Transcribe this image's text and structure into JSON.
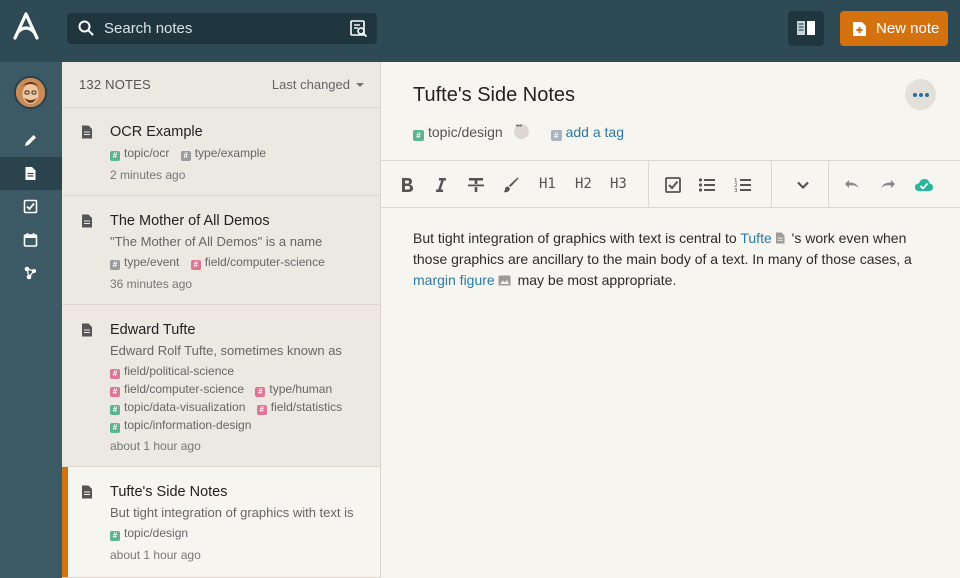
{
  "header": {
    "search_placeholder": "Search notes",
    "new_note_label": "New note"
  },
  "list": {
    "count": "132 NOTES",
    "sort_label": "Last changed",
    "notes": [
      {
        "title": "OCR Example",
        "preview": "",
        "tags": [
          {
            "name": "topic/ocr",
            "color": "#5bb58e"
          },
          {
            "name": "type/example",
            "color": "#9b9b9b"
          }
        ],
        "time": "2 minutes ago"
      },
      {
        "title": "The Mother of All Demos",
        "preview": "\"The Mother of All Demos\" is a name",
        "tags": [
          {
            "name": "type/event",
            "color": "#9b9b9b"
          },
          {
            "name": "field/computer-science",
            "color": "#e17595"
          }
        ],
        "time": "36 minutes ago"
      },
      {
        "title": "Edward Tufte",
        "preview": "Edward Rolf Tufte, sometimes known as",
        "tags": [
          {
            "name": "field/political-science",
            "color": "#e17595"
          },
          {
            "name": "field/computer-science",
            "color": "#e17595"
          },
          {
            "name": "type/human",
            "color": "#e17595"
          },
          {
            "name": "topic/data-visualization",
            "color": "#5bb58e"
          },
          {
            "name": "field/statistics",
            "color": "#e17595"
          },
          {
            "name": "topic/information-design",
            "color": "#5bb58e"
          }
        ],
        "time": "about 1 hour ago"
      },
      {
        "title": "Tufte's Side Notes",
        "preview": "But tight integration of graphics with text is",
        "tags": [
          {
            "name": "topic/design",
            "color": "#5bb58e"
          }
        ],
        "time": "about 1 hour ago"
      }
    ]
  },
  "editor": {
    "title": "Tufte's Side Notes",
    "tag": "topic/design",
    "add_tag": "add a tag",
    "toolbar": {
      "h1": "H1",
      "h2": "H2",
      "h3": "H3"
    },
    "body": {
      "part1": "But tight integration of graphics with text is central to ",
      "link1": "Tufte",
      "part2": " 's work even when those graphics are ancillary to the main body of a text. In many of those cases, a ",
      "link2": "margin figure",
      "part3": " may be most appropriate."
    }
  },
  "colors": {
    "header_bg": "#2e4a55",
    "accent_orange": "#d4720f",
    "link_blue": "#2b7aa6",
    "tag_green": "#5bb58e",
    "tag_pink": "#e17595",
    "tag_gray": "#9b9b9b"
  }
}
